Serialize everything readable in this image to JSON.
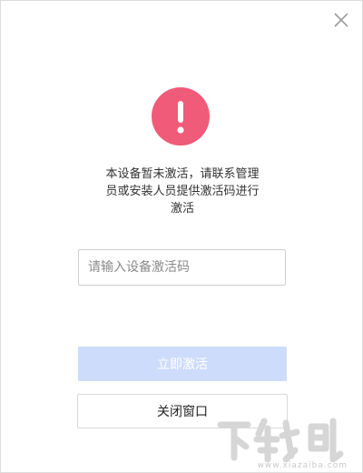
{
  "dialog": {
    "close_icon": "close-icon",
    "alert_icon": "exclamation-icon",
    "accent_color": "#ef5b78",
    "message_lines": [
      "本设备暂未激活，请联系管理",
      "员或安装人员提供激活码进行",
      "激活"
    ],
    "code_input": {
      "value": "",
      "placeholder": "请输入设备激活码"
    },
    "activate_button": {
      "label": "立即激活",
      "color": "#cddcfa"
    },
    "close_window_button": {
      "label": "关闭窗口"
    }
  },
  "watermark": {
    "brand": "下载吧",
    "url": "www.xiazaiba.com"
  }
}
